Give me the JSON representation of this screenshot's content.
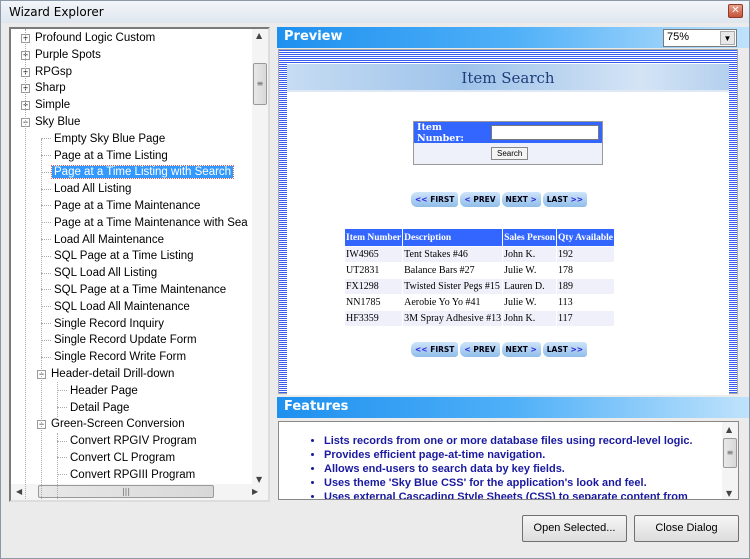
{
  "window": {
    "title": "Wizard Explorer",
    "close_icon": "close-icon"
  },
  "tree": {
    "items": [
      {
        "label": "Profound Logic Custom",
        "level": 1,
        "expander": "+"
      },
      {
        "label": "Purple Spots",
        "level": 1,
        "expander": "+"
      },
      {
        "label": "RPGsp",
        "level": 1,
        "expander": "+"
      },
      {
        "label": "Sharp",
        "level": 1,
        "expander": "+"
      },
      {
        "label": "Simple",
        "level": 1,
        "expander": "+"
      },
      {
        "label": "Sky Blue",
        "level": 1,
        "expander": "-"
      },
      {
        "label": "Empty Sky Blue Page",
        "level": 2
      },
      {
        "label": "Page at a Time Listing",
        "level": 2
      },
      {
        "label": "Page at a Time Listing with Search",
        "level": 2,
        "selected": true
      },
      {
        "label": "Load All Listing",
        "level": 2
      },
      {
        "label": "Page at a Time Maintenance",
        "level": 2
      },
      {
        "label": "Page at a Time Maintenance with Sea",
        "level": 2
      },
      {
        "label": "Load All Maintenance",
        "level": 2
      },
      {
        "label": "SQL Page at a Time Listing",
        "level": 2
      },
      {
        "label": "SQL Load All Listing",
        "level": 2
      },
      {
        "label": "SQL Page at a Time Maintenance",
        "level": 2
      },
      {
        "label": "SQL Load All Maintenance",
        "level": 2
      },
      {
        "label": "Single Record Inquiry",
        "level": 2
      },
      {
        "label": "Single Record Update Form",
        "level": 2
      },
      {
        "label": "Single Record Write Form",
        "level": 2
      },
      {
        "label": "Header-detail Drill-down",
        "level": 2,
        "expander": "-"
      },
      {
        "label": "Header Page",
        "level": 3
      },
      {
        "label": "Detail Page",
        "level": 3
      },
      {
        "label": "Green-Screen Conversion",
        "level": 2,
        "expander": "-"
      },
      {
        "label": "Convert RPGIV Program",
        "level": 3
      },
      {
        "label": "Convert CL Program",
        "level": 3
      },
      {
        "label": "Convert RPGIII Program",
        "level": 3
      }
    ]
  },
  "preview": {
    "header": "Preview",
    "zoom": "75%",
    "page_title": "Item Search",
    "search_label": "Item Number:",
    "search_value": "",
    "search_button": "Search",
    "nav": {
      "first": "FIRST",
      "prev": "PREV",
      "next": "NEXT",
      "last": "LAST"
    },
    "columns": [
      "Item Number",
      "Description",
      "Sales Person",
      "Qty Available"
    ],
    "rows": [
      [
        "IW4965",
        "Tent Stakes #46",
        "John K.",
        "192"
      ],
      [
        "UT2831",
        "Balance Bars #27",
        "Julie W.",
        "178"
      ],
      [
        "FX1298",
        "Twisted Sister Pegs #15",
        "Lauren D.",
        "189"
      ],
      [
        "NN1785",
        "Aerobie Yo Yo #41",
        "Julie W.",
        "113"
      ],
      [
        "HF3359",
        "3M Spray Adhesive #13",
        "John K.",
        "117"
      ]
    ]
  },
  "features": {
    "header": "Features",
    "items": [
      "Lists records from one or more database files using record-level logic.",
      "Provides efficient page-at-time navigation.",
      "Allows end-users to search data by key fields.",
      "Uses theme 'Sky Blue CSS' for the application's look and feel.",
      "Uses external Cascading Style Sheets (CSS) to separate content from"
    ]
  },
  "buttons": {
    "open": "Open Selected...",
    "close": "Close Dialog"
  },
  "colors": {
    "header_blue": "#1e90ef",
    "table_header": "#3366ff",
    "selection": "#3399ff",
    "features_text": "#1a1aa0"
  }
}
